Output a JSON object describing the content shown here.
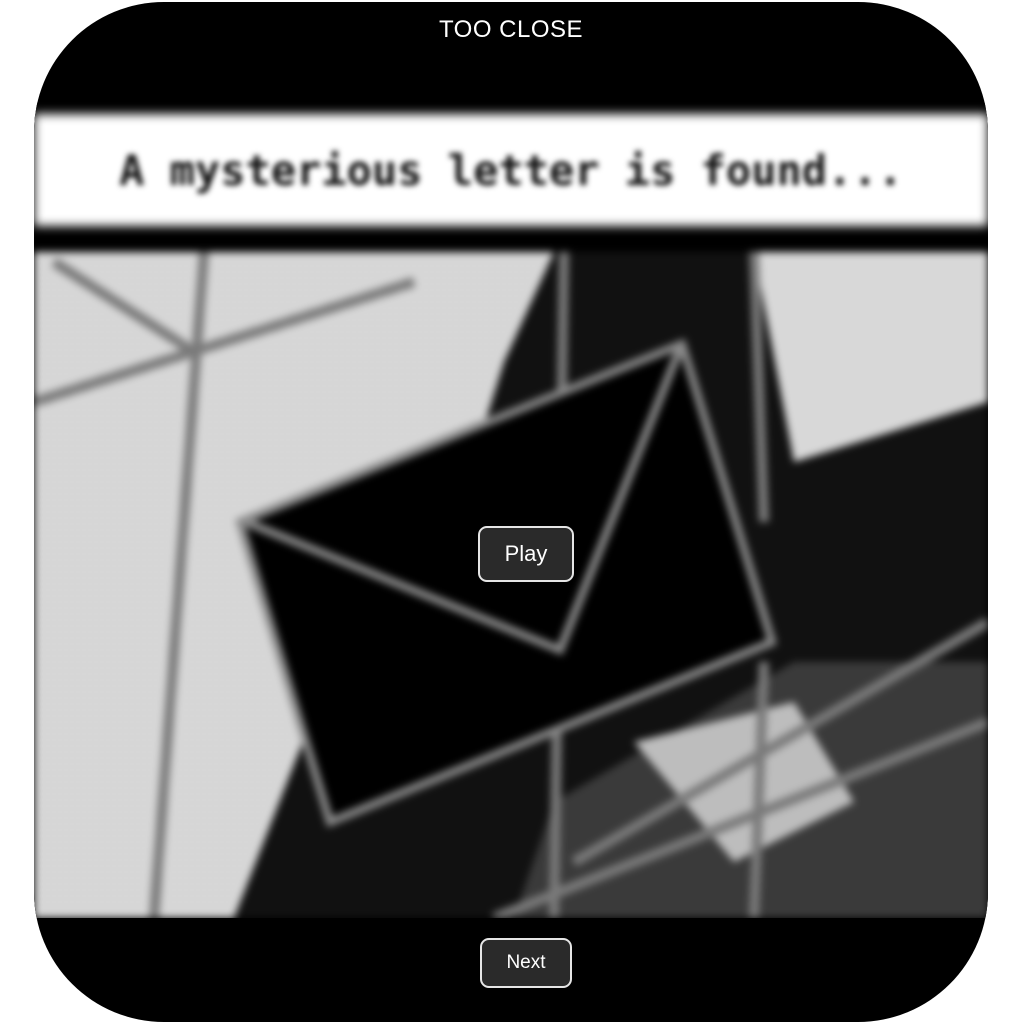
{
  "header": {
    "title": "TOO CLOSE"
  },
  "scene": {
    "caption": "A mysterious letter is found...",
    "illustration_icon": "envelope-icon"
  },
  "controls": {
    "play_label": "Play",
    "next_label": "Next"
  },
  "colors": {
    "background": "#000000",
    "button_fill": "#2a2a2a",
    "button_border": "#e6e6e6",
    "text": "#ffffff"
  }
}
